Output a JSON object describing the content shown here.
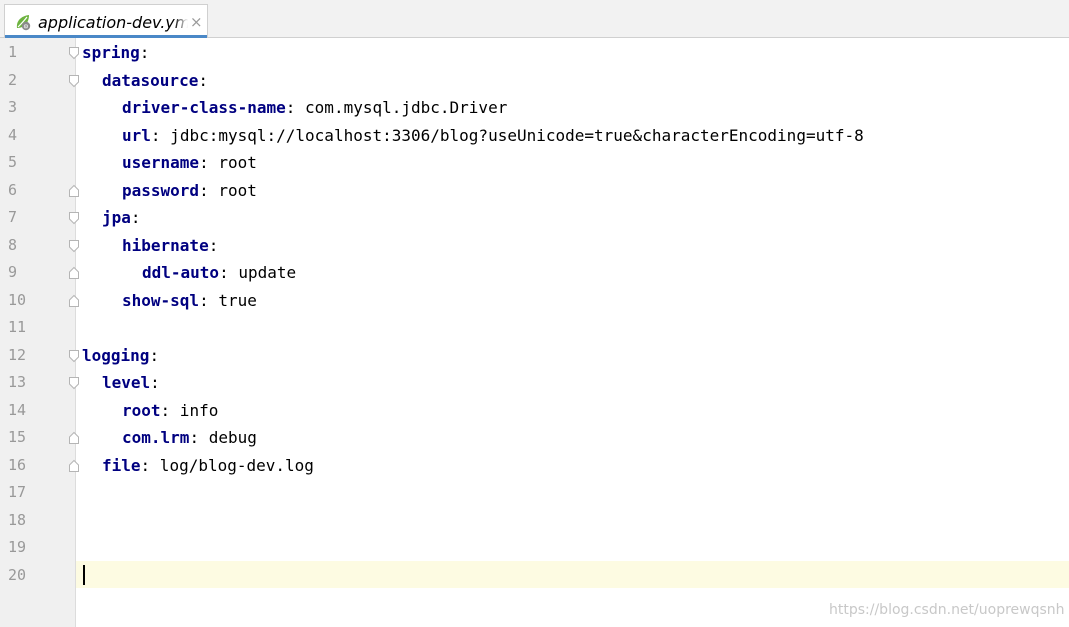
{
  "tab": {
    "title": "application-dev.yml",
    "icon": "spring-leaf-icon",
    "close_glyph": "×",
    "accent_color": "#4a88c7"
  },
  "editor": {
    "current_line": 20,
    "lines": [
      {
        "num": "1",
        "key": "spring",
        "colon": ":",
        "value": ""
      },
      {
        "num": "2",
        "key": "datasource",
        "colon": ":",
        "value": ""
      },
      {
        "num": "3",
        "key": "driver-class-name",
        "colon": ":",
        "value": " com.mysql.jdbc.Driver"
      },
      {
        "num": "4",
        "key": "url",
        "colon": ":",
        "value": " jdbc:mysql://localhost:3306/blog?useUnicode=true&characterEncoding=utf-8"
      },
      {
        "num": "5",
        "key": "username",
        "colon": ":",
        "value": " root"
      },
      {
        "num": "6",
        "key": "password",
        "colon": ":",
        "value": " root"
      },
      {
        "num": "7",
        "key": "jpa",
        "colon": ":",
        "value": ""
      },
      {
        "num": "8",
        "key": "hibernate",
        "colon": ":",
        "value": ""
      },
      {
        "num": "9",
        "key": "ddl-auto",
        "colon": ":",
        "value": " update"
      },
      {
        "num": "10",
        "key": "show-sql",
        "colon": ":",
        "value": " true"
      },
      {
        "num": "11",
        "key": "",
        "colon": "",
        "value": ""
      },
      {
        "num": "12",
        "key": "logging",
        "colon": ":",
        "value": ""
      },
      {
        "num": "13",
        "key": "level",
        "colon": ":",
        "value": ""
      },
      {
        "num": "14",
        "key": "root",
        "colon": ":",
        "value": " info"
      },
      {
        "num": "15",
        "key": "com.lrm",
        "colon": ":",
        "value": " debug"
      },
      {
        "num": "16",
        "key": "file",
        "colon": ":",
        "value": " log/blog-dev.log"
      },
      {
        "num": "17",
        "key": "",
        "colon": "",
        "value": ""
      },
      {
        "num": "18",
        "key": "",
        "colon": "",
        "value": ""
      },
      {
        "num": "19",
        "key": "",
        "colon": "",
        "value": ""
      },
      {
        "num": "20",
        "key": "",
        "colon": "",
        "value": ""
      }
    ],
    "key_color": "#000080"
  },
  "watermark": "https://blog.csdn.net/uoprewqsnh"
}
